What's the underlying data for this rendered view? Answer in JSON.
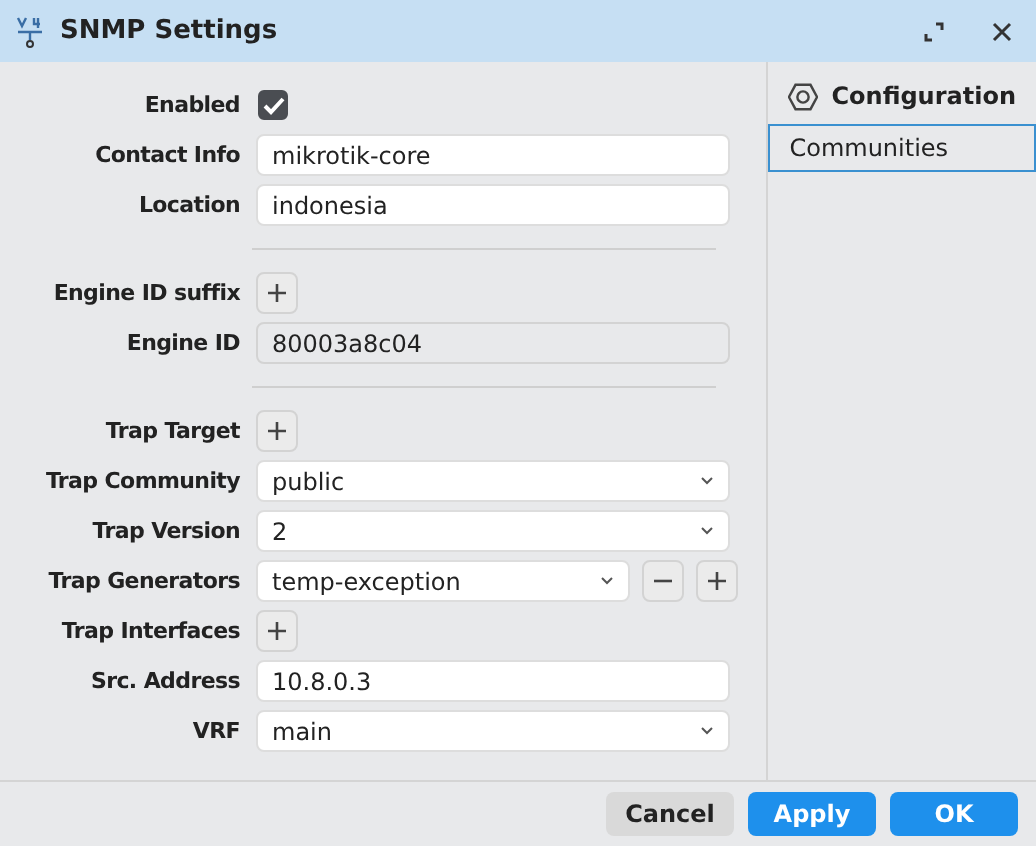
{
  "window": {
    "title": "SNMP Settings"
  },
  "fields": [
    {
      "kind": "checkbox",
      "label": "Enabled",
      "checked": true
    },
    {
      "kind": "text",
      "label": "Contact Info",
      "value": "mikrotik-core"
    },
    {
      "kind": "text",
      "label": "Location",
      "value": "indonesia"
    },
    {
      "kind": "divider"
    },
    {
      "kind": "add",
      "label": "Engine ID suffix"
    },
    {
      "kind": "readonly",
      "label": "Engine ID",
      "value": "80003a8c04"
    },
    {
      "kind": "divider"
    },
    {
      "kind": "add",
      "label": "Trap Target"
    },
    {
      "kind": "select",
      "label": "Trap Community",
      "value": "public"
    },
    {
      "kind": "select",
      "label": "Trap Version",
      "value": "2"
    },
    {
      "kind": "multiselect",
      "label": "Trap Generators",
      "value": "temp-exception"
    },
    {
      "kind": "add",
      "label": "Trap Interfaces"
    },
    {
      "kind": "text",
      "label": "Src. Address",
      "value": "10.8.0.3"
    },
    {
      "kind": "select",
      "label": "VRF",
      "value": "main"
    }
  ],
  "sidebar": {
    "heading": "Configuration",
    "items": [
      {
        "label": "Communities",
        "selected": true
      }
    ]
  },
  "buttons": [
    {
      "label": "Cancel",
      "kind": "secondary"
    },
    {
      "label": "Apply",
      "kind": "primary"
    },
    {
      "label": "OK",
      "kind": "primary"
    }
  ]
}
